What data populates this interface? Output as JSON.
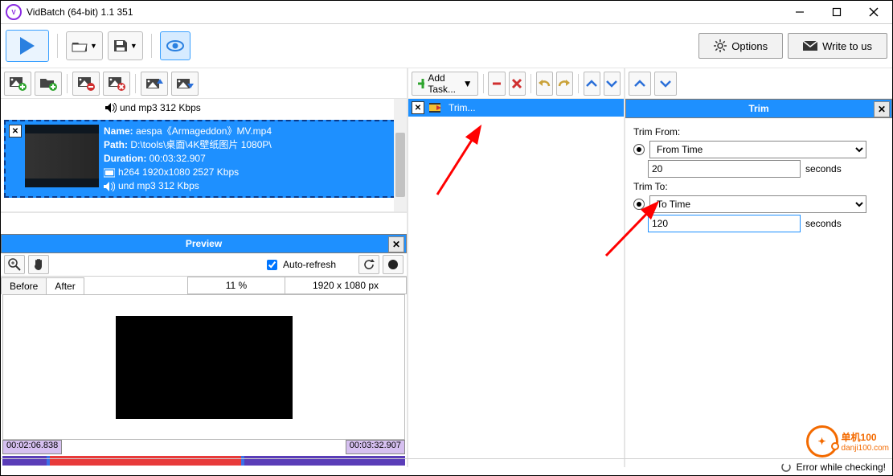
{
  "window": {
    "title": "VidBatch (64-bit) 1.1 351"
  },
  "main_toolbar": {
    "options_label": "Options",
    "write_label": "Write to us"
  },
  "file_partial": {
    "audio_line": "und mp3 312 Kbps"
  },
  "file": {
    "name_label": "Name:",
    "name": "aespa《Armageddon》MV.mp4",
    "path_label": "Path:",
    "path": "D:\\tools\\桌面\\4K壁纸图片 1080P\\",
    "duration_label": "Duration:",
    "duration": "00:03:32.907",
    "video_line": "h264 1920x1080 2527 Kbps",
    "audio_line": "und mp3 312 Kbps"
  },
  "preview": {
    "title": "Preview",
    "auto_refresh": "Auto-refresh",
    "tab_before": "Before",
    "tab_after": "After",
    "percent": "11 %",
    "dims": "1920 x 1080 px",
    "time_start": "00:02:06.838",
    "time_end": "00:03:32.907"
  },
  "tasks": {
    "add_label": "Add Task...",
    "item1": "Trim..."
  },
  "trim": {
    "title": "Trim",
    "from_label": "Trim From:",
    "from_mode": "From Time",
    "from_value": "20",
    "from_unit": "seconds",
    "to_label": "Trim To:",
    "to_mode": "To Time",
    "to_value": "120",
    "to_unit": "seconds"
  },
  "status": {
    "msg": "Error while checking!"
  },
  "watermark": {
    "text1": "单机100",
    "text2": "danji100.com"
  }
}
